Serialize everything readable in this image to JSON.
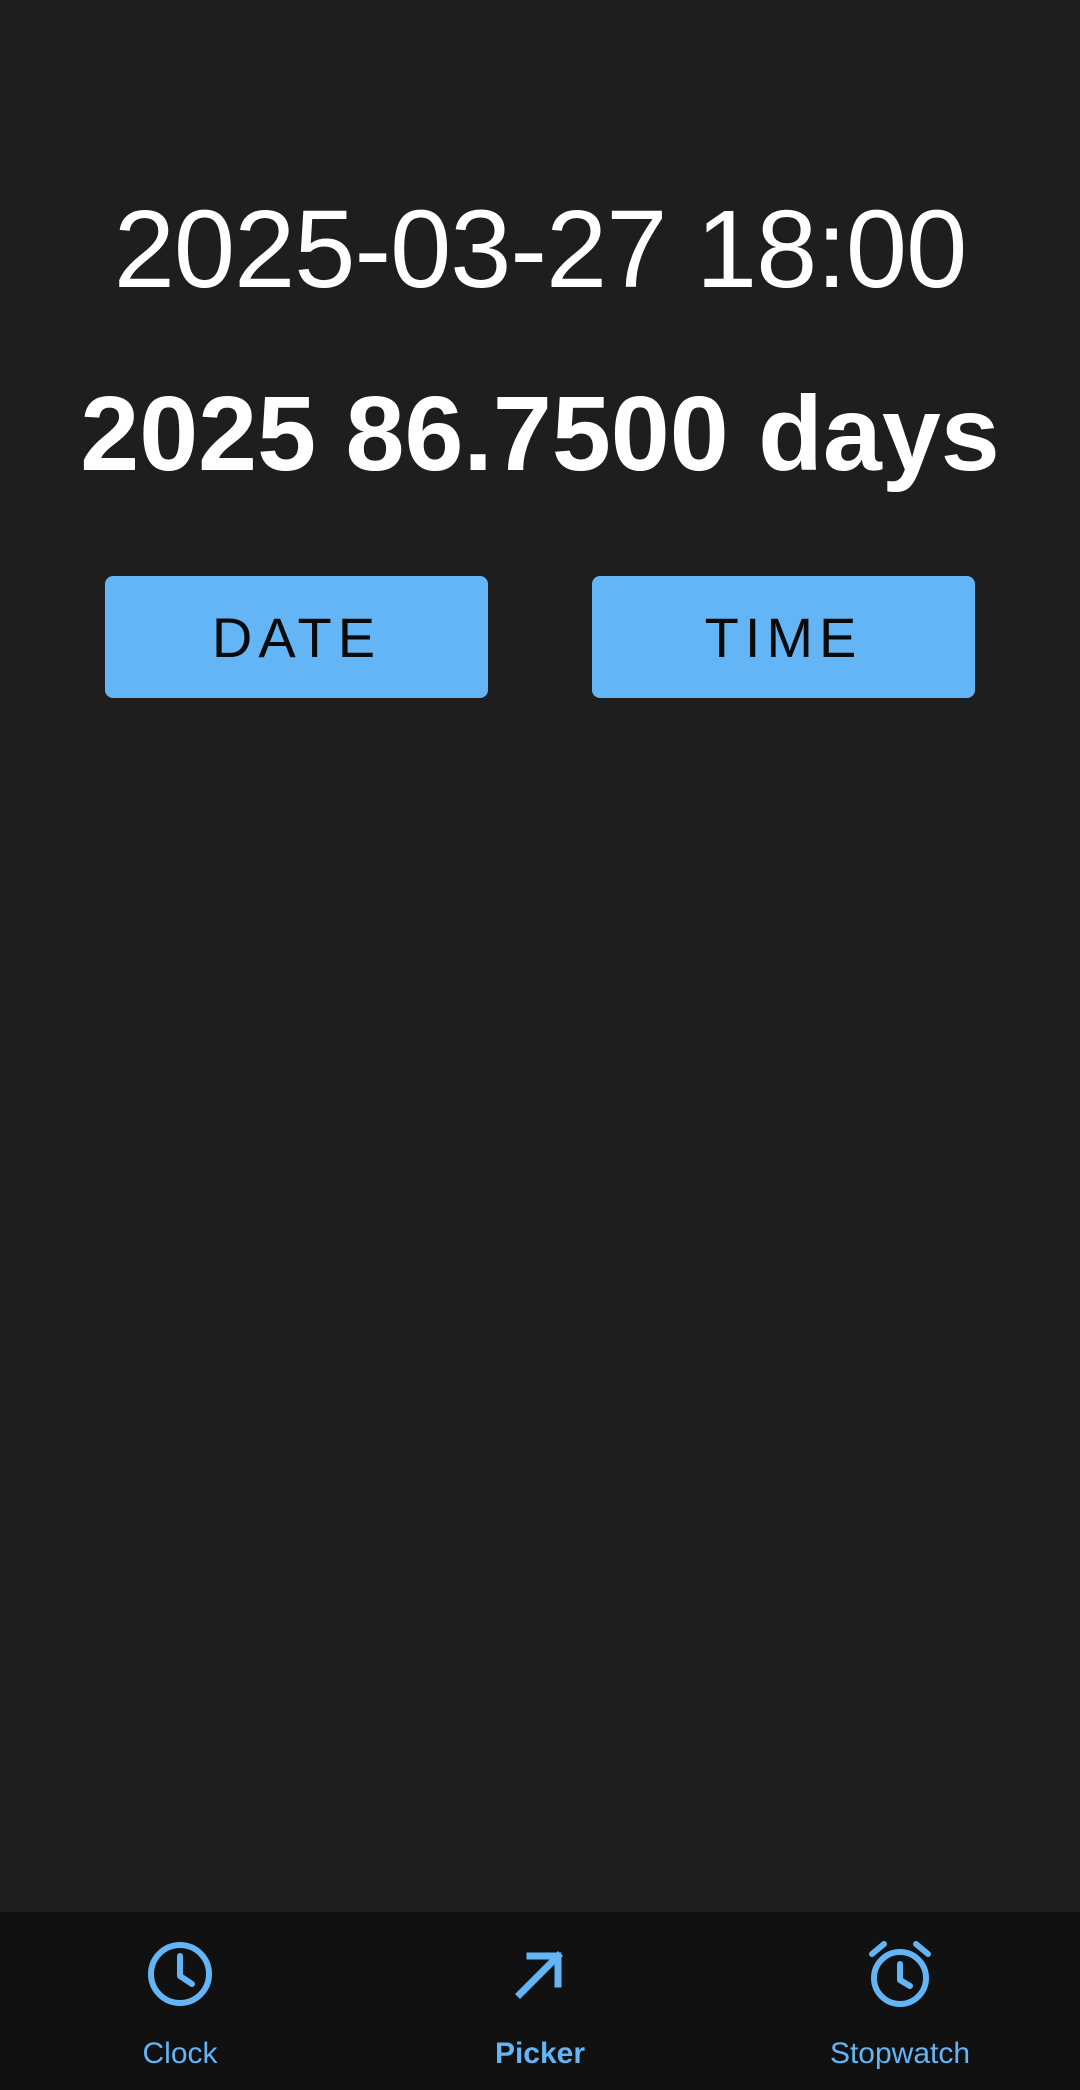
{
  "main": {
    "datetime": "2025-03-27 18:00",
    "day_of_year": "2025 86.7500 days",
    "date_button_label": "DATE",
    "time_button_label": "TIME"
  },
  "bottom_nav": {
    "items": [
      {
        "label": "Clock",
        "icon": "clock-icon",
        "active": false
      },
      {
        "label": "Picker",
        "icon": "arrow-up-right-icon",
        "active": true
      },
      {
        "label": "Stopwatch",
        "icon": "alarm-clock-icon",
        "active": false
      }
    ],
    "accent_color": "#64b5f6"
  },
  "colors": {
    "background": "#1e1e1e",
    "nav_background": "#111111",
    "button": "#64b5f6",
    "text": "#ffffff"
  }
}
